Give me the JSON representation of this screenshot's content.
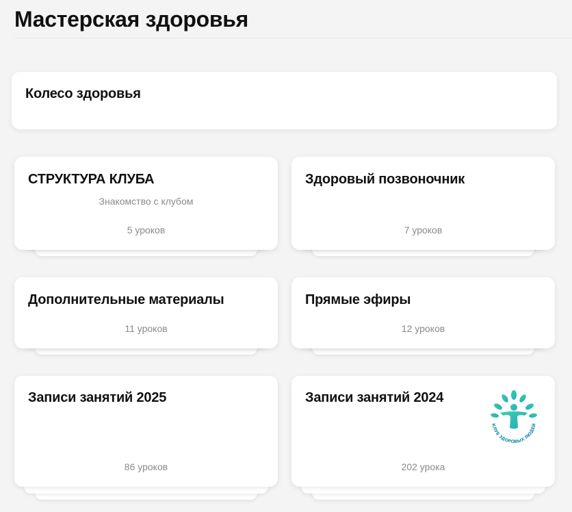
{
  "page": {
    "title": "Мастерская здоровья"
  },
  "wide_card": {
    "title": "Колесо здоровья"
  },
  "courses": [
    {
      "title": "СТРУКТУРА КЛУБА",
      "subtitle": "Знакомство с клубом",
      "count": "5 уроков"
    },
    {
      "title": "Здоровый позвоночник",
      "subtitle": "",
      "count": "7 уроков"
    },
    {
      "title": "Дополнительные материалы",
      "subtitle": "",
      "count": "11 уроков"
    },
    {
      "title": "Прямые эфиры",
      "subtitle": "",
      "count": "12 уроков"
    },
    {
      "title": "Записи занятий 2025",
      "subtitle": "",
      "count": "86 уроков"
    },
    {
      "title": "Записи занятий 2024",
      "subtitle": "",
      "count": "202 урока",
      "logo_text": "КЛУБ ЗДОРОВЫХ ЛЮДЕЙ"
    }
  ],
  "colors": {
    "background": "#f4f4f4",
    "card": "#ffffff",
    "logo_teal": "#2cc1b0"
  },
  "icons": {
    "logo": "tree-person-logo"
  }
}
